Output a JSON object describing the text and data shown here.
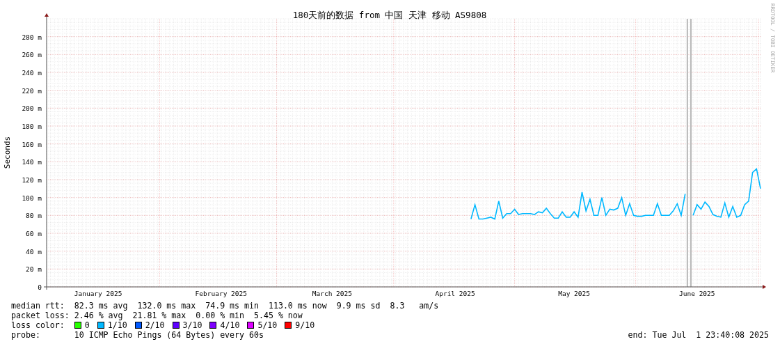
{
  "chart": {
    "chart_data": {
      "type": "line",
      "title": "180天前的数据 from 中国 天津 移动 AS9808",
      "ylabel": "Seconds",
      "ylim": [
        0,
        300
      ],
      "categories": [
        null,
        null,
        null,
        null,
        null,
        null,
        null,
        null,
        null,
        null,
        null,
        null,
        null,
        "January 2025",
        null,
        null,
        null,
        null,
        null,
        null,
        null,
        null,
        null,
        null,
        null,
        null,
        null,
        null,
        null,
        null,
        null,
        null,
        null,
        null,
        null,
        null,
        null,
        null,
        null,
        null,
        null,
        null,
        null,
        null,
        "February 2025",
        null,
        null,
        null,
        null,
        null,
        null,
        null,
        null,
        null,
        null,
        null,
        null,
        null,
        null,
        null,
        null,
        null,
        null,
        null,
        null,
        null,
        null,
        null,
        null,
        null,
        null,
        null,
        "March 2025",
        null,
        null,
        null,
        null,
        null,
        null,
        null,
        null,
        null,
        null,
        null,
        null,
        null,
        null,
        null,
        null,
        null,
        null,
        null,
        null,
        null,
        null,
        null,
        null,
        null,
        null,
        null,
        null,
        null,
        null,
        "April 2025",
        null,
        null,
        null,
        null,
        null,
        null,
        null,
        null,
        null,
        null,
        null,
        null,
        null,
        null,
        null,
        null,
        null,
        null,
        null,
        null,
        null,
        null,
        null,
        null,
        null,
        null,
        null,
        null,
        null,
        "May 2025",
        null,
        null,
        null,
        null,
        null,
        null,
        null,
        null,
        null,
        null,
        null,
        null,
        null,
        null,
        null,
        null,
        null,
        null,
        null,
        null,
        null,
        null,
        null,
        null,
        null,
        null,
        null,
        null,
        null,
        null,
        "June 2025",
        null,
        null,
        null,
        null,
        null,
        null,
        null,
        null,
        null,
        null,
        null,
        null,
        null,
        null,
        null,
        null
      ],
      "yticks": [
        0,
        {
          "value": 20,
          "label": "20 m"
        },
        {
          "value": 40,
          "label": "40 m"
        },
        {
          "value": 60,
          "label": "60 m"
        },
        {
          "value": 80,
          "label": "80 m"
        },
        {
          "value": 100,
          "label": "100 m"
        },
        {
          "value": 120,
          "label": "120 m"
        },
        {
          "value": 140,
          "label": "140 m"
        },
        {
          "value": 160,
          "label": "160 m"
        },
        {
          "value": 180,
          "label": "180 m"
        },
        {
          "value": 200,
          "label": "200 m"
        },
        {
          "value": 220,
          "label": "220 m"
        },
        {
          "value": 240,
          "label": "240 m"
        },
        {
          "value": 260,
          "label": "260 m"
        },
        {
          "value": 280,
          "label": "280 m"
        }
      ],
      "series": [
        {
          "color": "#00b8ff",
          "values": [
            null,
            null,
            null,
            null,
            null,
            null,
            null,
            null,
            null,
            null,
            null,
            null,
            null,
            null,
            null,
            null,
            null,
            null,
            null,
            null,
            null,
            null,
            null,
            null,
            null,
            null,
            null,
            null,
            null,
            null,
            null,
            null,
            null,
            null,
            null,
            null,
            null,
            null,
            null,
            null,
            null,
            null,
            null,
            null,
            null,
            null,
            null,
            null,
            null,
            null,
            null,
            null,
            null,
            null,
            null,
            null,
            null,
            null,
            null,
            null,
            null,
            null,
            null,
            null,
            null,
            null,
            null,
            null,
            null,
            null,
            null,
            null,
            null,
            null,
            null,
            null,
            null,
            null,
            null,
            null,
            null,
            null,
            null,
            null,
            null,
            null,
            null,
            null,
            null,
            null,
            null,
            null,
            null,
            null,
            null,
            null,
            null,
            null,
            null,
            null,
            null,
            null,
            null,
            null,
            null,
            null,
            null,
            76,
            92,
            76,
            76,
            77,
            78,
            76,
            96,
            77,
            82,
            82,
            87,
            81,
            82,
            82,
            82,
            81,
            84,
            83,
            88,
            82,
            77,
            77,
            84,
            78,
            78,
            84,
            78,
            106,
            85,
            98,
            80,
            80,
            100,
            80,
            87,
            86,
            88,
            100,
            80,
            93,
            80,
            79,
            79,
            80,
            80,
            80,
            93,
            80,
            80,
            80,
            85,
            93,
            80,
            104,
            null,
            80,
            92,
            87,
            95,
            90,
            81,
            79,
            78,
            94,
            78,
            90,
            78,
            80,
            92,
            96,
            128,
            132,
            110
          ]
        }
      ],
      "grid": true
    }
  },
  "credit": "RRDTOOL / TOBI OETIKER",
  "legend": {
    "rows": [
      {
        "label": "median rtt:",
        "text": "82.3 ms avg  132.0 ms max  74.9 ms min  113.0 ms now  9.9 ms sd  8.3   am/s"
      },
      {
        "label": "packet loss:",
        "text": "2.46 % avg  21.81 % max  0.00 % min  5.45 % now"
      }
    ],
    "loss_color": {
      "label": "loss color:",
      "items": [
        {
          "label": "0",
          "color": "#26ff00"
        },
        {
          "label": "1/10",
          "color": "#00b8ff"
        },
        {
          "label": "2/10",
          "color": "#0059ff"
        },
        {
          "label": "3/10",
          "color": "#5e00ff"
        },
        {
          "label": "4/10",
          "color": "#7e00ff"
        },
        {
          "label": "5/10",
          "color": "#dd00ff"
        },
        {
          "label": "9/10",
          "color": "#ff0000"
        }
      ]
    },
    "probe": {
      "label": "probe:",
      "text": "10 ICMP Echo Pings (64 Bytes) every 60s"
    },
    "end": "end: Tue Jul  1 23:40:08 2025"
  }
}
